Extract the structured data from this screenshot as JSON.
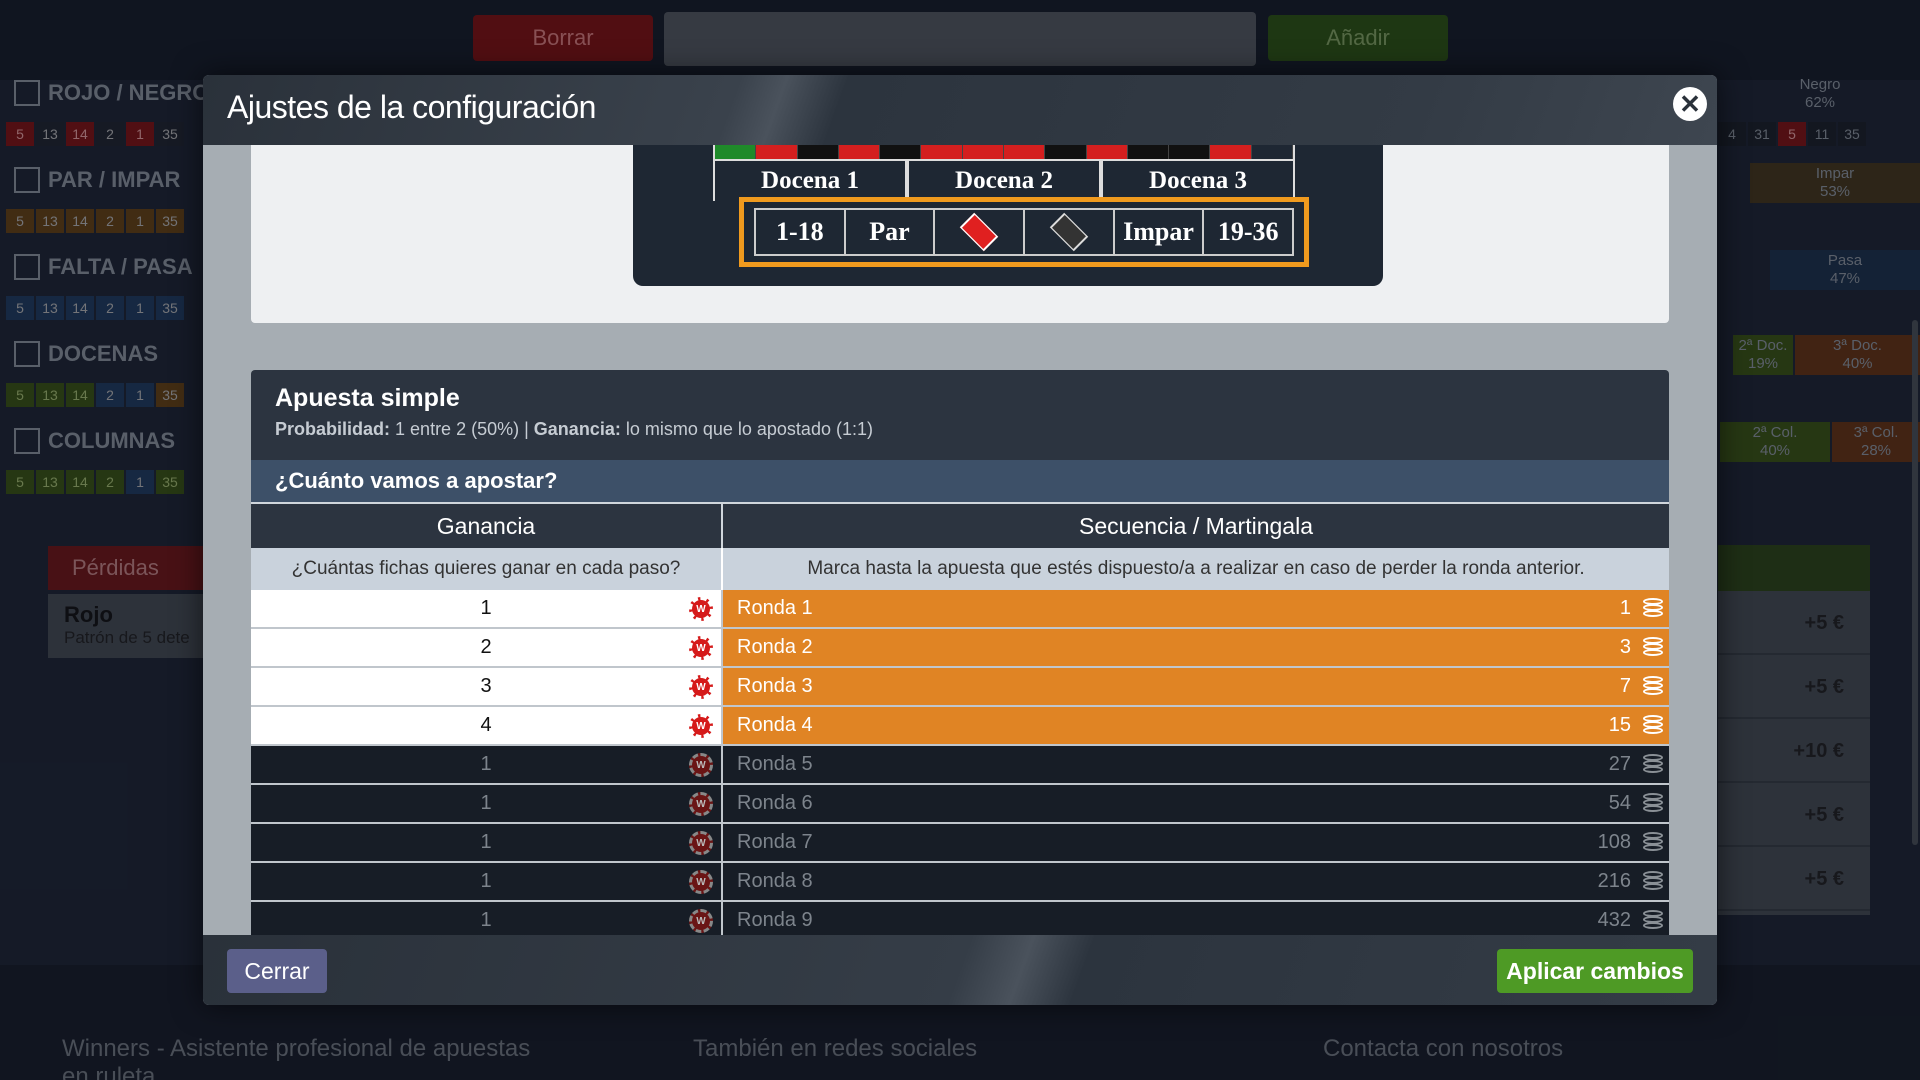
{
  "background": {
    "borrar_label": "Borrar",
    "anadir_label": "Añadir",
    "sections": [
      {
        "title": "ROJO / NEGRO",
        "numbers": [
          "5",
          "13",
          "14",
          "2",
          "1",
          "35"
        ]
      },
      {
        "title": "PAR / IMPAR",
        "numbers": [
          "5",
          "13",
          "14",
          "2",
          "1",
          "35"
        ]
      },
      {
        "title": "FALTA / PASA",
        "numbers": [
          "5",
          "13",
          "14",
          "2",
          "1",
          "35"
        ]
      },
      {
        "title": "DOCENAS",
        "numbers": [
          "5",
          "13",
          "14",
          "2",
          "1",
          "35"
        ]
      },
      {
        "title": "COLUMNAS",
        "numbers": [
          "5",
          "13",
          "14",
          "2",
          "1",
          "35"
        ]
      }
    ],
    "right_stats": [
      {
        "label": "Negro",
        "value": "62%"
      },
      {
        "label": "Impar",
        "value": "53%"
      },
      {
        "label": "Pasa",
        "value": "47%"
      },
      {
        "label": "2ª Doc.",
        "value": "19%"
      },
      {
        "label": "3ª Doc.",
        "value": "40%"
      },
      {
        "label": "2ª Col.",
        "value": "40%"
      },
      {
        "label": "3ª Col.",
        "value": "28%"
      }
    ],
    "right_numbers": [
      "4",
      "31",
      "5",
      "11",
      "35"
    ],
    "perdidas_label": "Pérdidas",
    "card_title": "Rojo",
    "card_subtitle": "Patrón de 5 dete",
    "profits": [
      "+5 €",
      "+5 €",
      "+10 €",
      "+5 €",
      "+5 €"
    ],
    "footer": {
      "col1": "Winners - Asistente profesional de apuestas en ruleta",
      "col2": "También en redes sociales",
      "col3": "Contacta con nosotros"
    }
  },
  "modal": {
    "title": "Ajustes de la configuración",
    "close_icon": "close-icon",
    "roulette": {
      "dozens": [
        "Docena 1",
        "Docena 2",
        "Docena 3"
      ],
      "bets": [
        "1-18",
        "Par",
        "red-diamond",
        "black-diamond",
        "Impar",
        "19-36"
      ],
      "highlight_color": "#f09a1e"
    },
    "bet": {
      "title": "Apuesta simple",
      "prob_label": "Probabilidad:",
      "prob_value": "1 entre 2 (50%) |",
      "gain_label": "Ganancia:",
      "gain_value": "lo mismo que lo apostado (1:1)",
      "question": "¿Cuánto vamos a apostar?",
      "col_ganancia": "Ganancia",
      "col_secuencia": "Secuencia / Martingala",
      "sub_ganancia": "¿Cuántas fichas quieres ganar en cada paso?",
      "sub_secuencia": "Marca hasta la apuesta que estés dispuesto/a a realizar en caso de perder la ronda anterior.",
      "rows": [
        {
          "gain": "1",
          "round": "Ronda 1",
          "amount": "1",
          "active": true
        },
        {
          "gain": "2",
          "round": "Ronda 2",
          "amount": "3",
          "active": true
        },
        {
          "gain": "3",
          "round": "Ronda 3",
          "amount": "7",
          "active": true
        },
        {
          "gain": "4",
          "round": "Ronda 4",
          "amount": "15",
          "active": true
        },
        {
          "gain": "1",
          "round": "Ronda 5",
          "amount": "27",
          "active": false
        },
        {
          "gain": "1",
          "round": "Ronda 6",
          "amount": "54",
          "active": false
        },
        {
          "gain": "1",
          "round": "Ronda 7",
          "amount": "108",
          "active": false
        },
        {
          "gain": "1",
          "round": "Ronda 8",
          "amount": "216",
          "active": false
        },
        {
          "gain": "1",
          "round": "Ronda 9",
          "amount": "432",
          "active": false
        }
      ]
    },
    "cerrar_label": "Cerrar",
    "aplicar_label": "Aplicar cambios",
    "colors": {
      "active_row": "#e08424",
      "apply": "#4e9a25",
      "close_btn": "#5b5f8a"
    }
  }
}
